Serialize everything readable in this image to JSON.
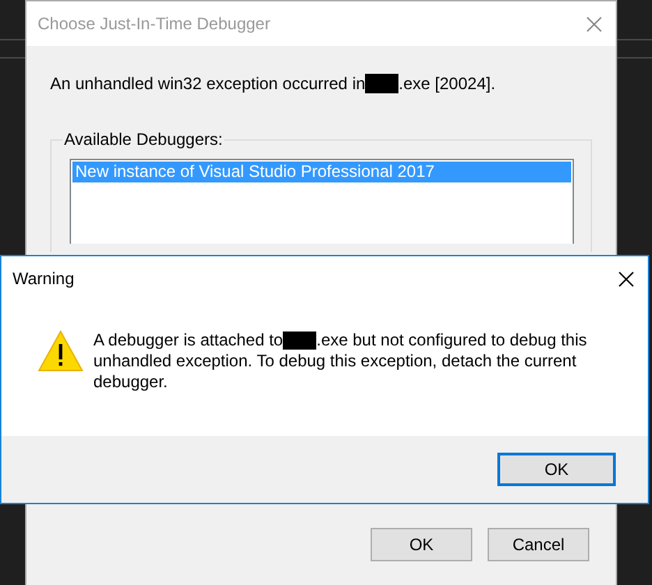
{
  "background_window": {
    "title": "Choose Just-In-Time Debugger",
    "message_before": "An unhandled win32 exception occurred in",
    "message_after": ".exe [20024].",
    "group_label": "Available Debuggers:",
    "debuggers": [
      {
        "label": "New instance of Visual Studio Professional 2017",
        "selected": true
      }
    ],
    "buttons": [
      {
        "label": "OK",
        "focused": false
      },
      {
        "label": "Cancel",
        "focused": false
      }
    ]
  },
  "warning_dialog": {
    "title": "Warning",
    "message_before": "A debugger is attached to",
    "message_after": ".exe but not configured to debug this",
    "message_continued": "unhandled exception. To debug this exception, detach the current debugger.",
    "buttons": [
      {
        "label": "OK",
        "focused": true
      }
    ]
  }
}
